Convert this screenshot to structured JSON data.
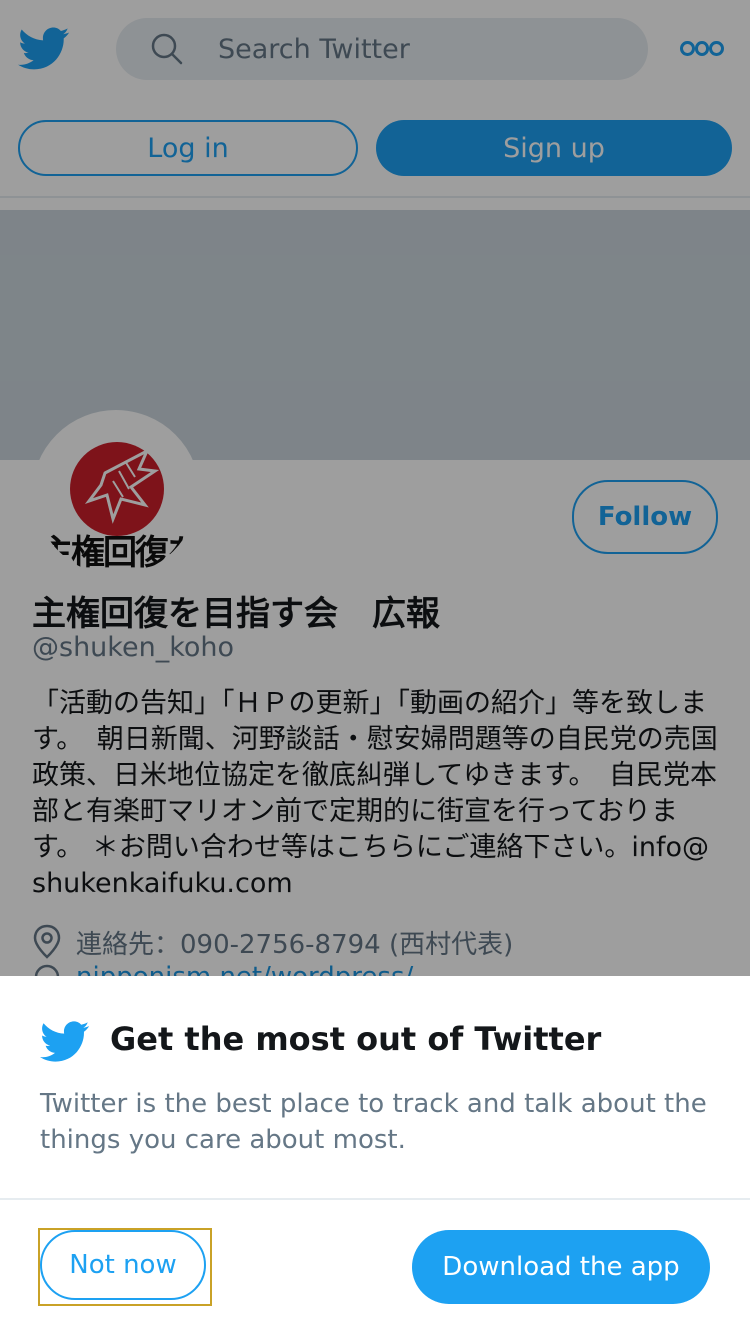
{
  "header": {
    "search_placeholder": "Search Twitter",
    "login_label": "Log in",
    "signup_label": "Sign up",
    "logo_icon": "twitter-bird-icon",
    "more_icon": "more-options-icon"
  },
  "profile": {
    "avatar_text": "主権回復を",
    "follow_label": "Follow",
    "name": "主権回復を目指す会　広報",
    "handle": "@shuken_koho",
    "bio": "「活動の告知」「ＨＰの更新」「動画の紹介」等を致します。　朝日新聞、河野談話・慰安婦問題等の自民党の売国政策、日米地位協定を徹底糾弾してゆきます。　自民党本部と有楽町マリオン前で定期的に街宣を行っております。 ＊お問い合わせ等はこちらにご連絡下さい。info@shukenkaifuku.com",
    "location": "連絡先：090-2756-8794 (西村代表)",
    "url": "nipponism.net/wordpress/"
  },
  "sheet": {
    "title": "Get the most out of Twitter",
    "description": "Twitter is the best place to track and talk about the things you care about most.",
    "not_now_label": "Not now",
    "download_label": "Download the app"
  },
  "colors": {
    "accent": "#1da1f2",
    "secondary_text": "#657786",
    "banner": "#ccd6dd"
  }
}
